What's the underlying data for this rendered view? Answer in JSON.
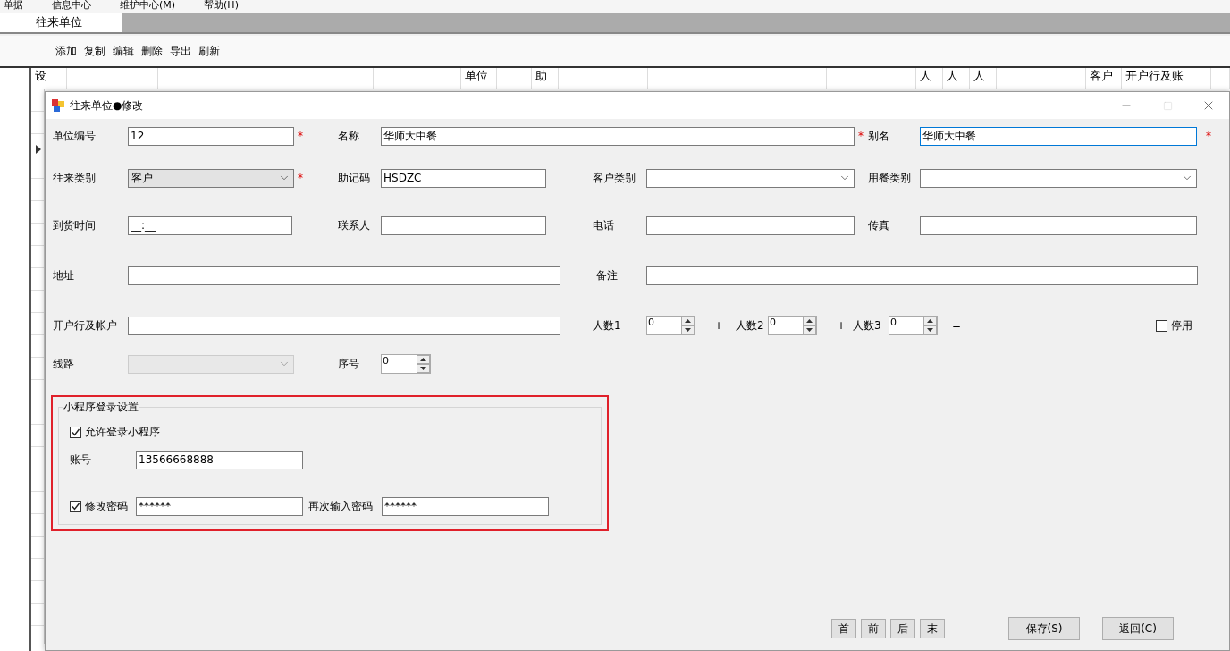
{
  "menu": [
    "单据",
    "信息中心",
    "维护中心(M)",
    "帮助(H)"
  ],
  "tabs": [
    {
      "label": "往来单位",
      "selected": true
    }
  ],
  "toolbar": [
    "添加",
    "复制",
    "编辑",
    "删除",
    "导出",
    "刷新"
  ],
  "grid": {
    "columns": [
      "设",
      "单位",
      "助",
      "人",
      "人",
      "人",
      "客户",
      "开户行及账"
    ]
  },
  "dialog": {
    "title": "往来单位●修改",
    "lines": [
      {
        "items": [
          {
            "kind": "label",
            "text": "单位编号"
          },
          {
            "kind": "input",
            "value": "12"
          },
          {
            "kind": "mark",
            "text": "*"
          },
          {
            "kind": "label",
            "text": "名称"
          },
          {
            "kind": "input",
            "value": "华师大中餐"
          },
          {
            "kind": "mark",
            "text": "*"
          },
          {
            "kind": "label",
            "text": "别名"
          },
          {
            "kind": "input",
            "value": "华师大中餐",
            "focused": true
          },
          {
            "kind": "mark",
            "text": "*"
          }
        ]
      },
      {
        "items": [
          {
            "kind": "label",
            "text": "往来类别"
          },
          {
            "kind": "select",
            "value": "客户",
            "disabled": false
          },
          {
            "kind": "mark",
            "text": "*"
          },
          {
            "kind": "label",
            "text": "助记码"
          },
          {
            "kind": "input",
            "value": "HSDZC"
          },
          {
            "kind": "label",
            "text": "客户类别"
          },
          {
            "kind": "select",
            "disabled": false
          },
          {
            "kind": "label",
            "text": "用餐类别"
          },
          {
            "kind": "select",
            "disabled": false
          }
        ]
      },
      {
        "items": [
          {
            "kind": "label",
            "text": "到货时间"
          },
          {
            "kind": "input",
            "value": "__:__"
          },
          {
            "kind": "label",
            "text": "联系人"
          },
          {
            "kind": "input"
          },
          {
            "kind": "label",
            "text": "电话"
          },
          {
            "kind": "input"
          },
          {
            "kind": "label",
            "text": "传真"
          },
          {
            "kind": "input"
          }
        ]
      },
      {
        "items": [
          {
            "kind": "label",
            "text": "地址"
          },
          {
            "kind": "input"
          },
          {
            "kind": "label",
            "text": "备注"
          },
          {
            "kind": "input"
          }
        ]
      },
      {
        "items": [
          {
            "kind": "label",
            "text": "开户行及帐户"
          },
          {
            "kind": "input"
          },
          {
            "kind": "label",
            "text": "人数1"
          },
          {
            "kind": "spinner",
            "value": "0"
          },
          {
            "kind": "op",
            "text": "+"
          },
          {
            "kind": "label",
            "text": "人数2"
          },
          {
            "kind": "spinner",
            "value": "0"
          },
          {
            "kind": "op",
            "text": "+"
          },
          {
            "kind": "label",
            "text": "人数3"
          },
          {
            "kind": "spinner",
            "value": "0"
          },
          {
            "kind": "op",
            "text": "="
          },
          {
            "kind": "checkbox",
            "label": "停用",
            "checked": false
          }
        ]
      },
      {
        "items": [
          {
            "kind": "label",
            "text": "线路"
          },
          {
            "kind": "select",
            "disabled": true
          },
          {
            "kind": "label",
            "text": "序号"
          },
          {
            "kind": "spinner",
            "value": "0"
          }
        ]
      }
    ],
    "login_group": {
      "title": "小程序登录设置",
      "allow": {
        "label": "允许登录小程序",
        "checked": true
      },
      "account": {
        "label": "账号",
        "value": "13566668888"
      },
      "change_password": {
        "label": "修改密码",
        "checked": true,
        "value": "******"
      },
      "repeat_password": {
        "label": "再次输入密码",
        "value": "******"
      }
    },
    "nav_buttons": [
      "首",
      "前",
      "后",
      "末"
    ],
    "actions": [
      "保存(S)",
      "返回(C)"
    ]
  }
}
